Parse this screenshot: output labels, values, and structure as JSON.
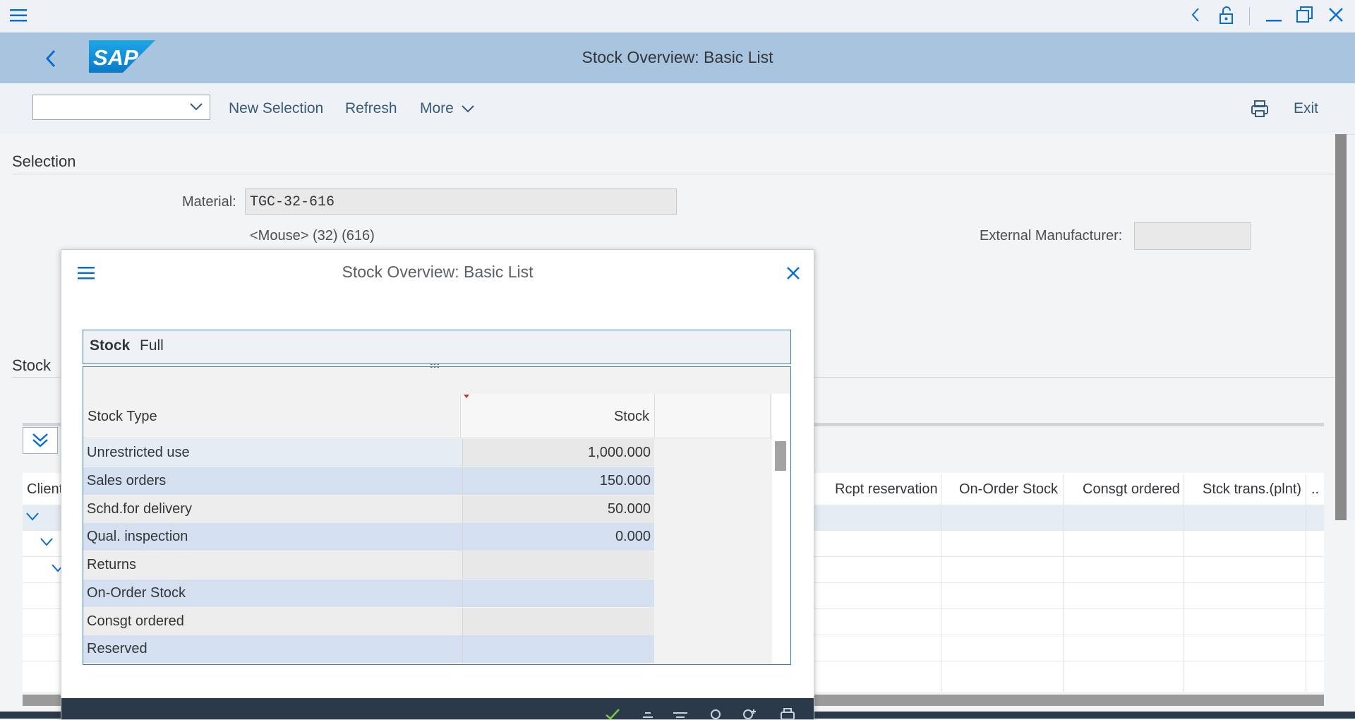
{
  "shell": {
    "title": "Stock Overview: Basic List",
    "logo_text": "SAP"
  },
  "toolbar": {
    "tcode_value": "",
    "new_selection": "New Selection",
    "refresh": "Refresh",
    "more": "More",
    "exit": "Exit"
  },
  "selection": {
    "section_title": "Selection",
    "material_label": "Material:",
    "material_value": "TGC-32-616",
    "material_desc": "<Mouse> (32) (616)",
    "ext_mfr_label": "External Manufacturer:",
    "ext_mfr_value": ""
  },
  "stock_section": {
    "title": "Stock",
    "columns": [
      "Client",
      "Rcpt reservation",
      "On-Order Stock",
      "Consgt ordered",
      "Stck trans.(plnt)",
      ".."
    ]
  },
  "dialog": {
    "title": "Stock Overview: Basic List",
    "group_bold": "Stock",
    "group_value": "Full",
    "col_stock_type": "Stock Type",
    "col_stock": "Stock",
    "rows": [
      {
        "type": "Unrestricted use",
        "stock": "1,000.000"
      },
      {
        "type": "Sales orders",
        "stock": "150.000"
      },
      {
        "type": "Schd.for delivery",
        "stock": "50.000"
      },
      {
        "type": "Qual. inspection",
        "stock": "0.000"
      },
      {
        "type": "Returns",
        "stock": ""
      },
      {
        "type": "On-Order Stock",
        "stock": ""
      },
      {
        "type": "Consgt ordered",
        "stock": ""
      },
      {
        "type": "Reserved",
        "stock": ""
      }
    ]
  },
  "colors": {
    "shell_bg": "#a9c4de",
    "row_alt": "#d4e0ef",
    "row_plain": "#ededed",
    "accent": "#0a6ed1",
    "footer": "#2b3a4a"
  }
}
